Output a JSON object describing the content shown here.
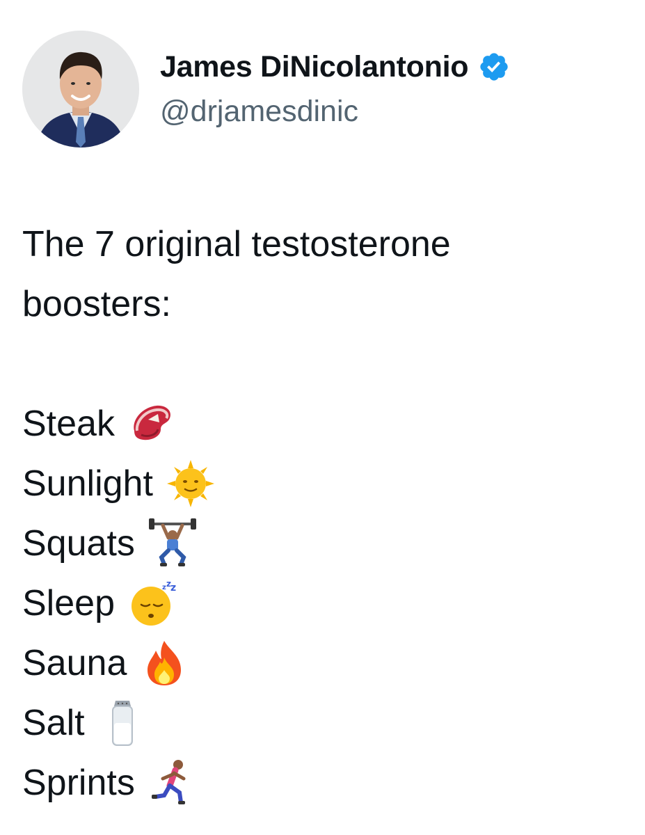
{
  "author": {
    "display_name": "James DiNicolantonio",
    "handle": "@drjamesdinic",
    "verified": true,
    "avatar_icon": "profile-photo",
    "verified_icon": "verified-badge-icon",
    "verified_color": "#1d9bf0"
  },
  "tweet": {
    "intro_line_1": "The 7 original testosterone",
    "intro_line_2": "boosters:",
    "items": [
      {
        "label": "Steak",
        "icon": "steak-icon"
      },
      {
        "label": "Sunlight",
        "icon": "sun-with-face-icon"
      },
      {
        "label": "Squats",
        "icon": "weight-lifter-icon"
      },
      {
        "label": "Sleep",
        "icon": "sleeping-face-icon"
      },
      {
        "label": "Sauna",
        "icon": "fire-icon"
      },
      {
        "label": "Salt",
        "icon": "salt-shaker-icon"
      },
      {
        "label": "Sprints",
        "icon": "runner-icon"
      }
    ]
  },
  "colors": {
    "text_primary": "#0f1419",
    "text_secondary": "#536471",
    "background": "#ffffff"
  }
}
